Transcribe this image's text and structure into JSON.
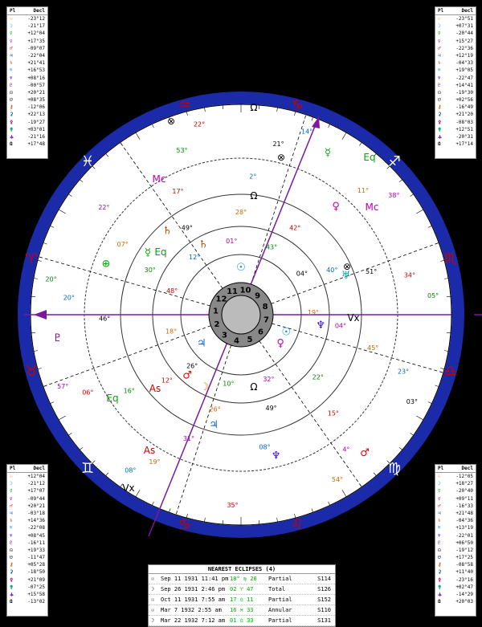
{
  "decl_tables": {
    "header_left": "Pl",
    "header_right": "Decl",
    "top_left": [
      "-23°12",
      "-21°17",
      "+12°04",
      "+17°35",
      "-09°07",
      "-22°04",
      "+21°41",
      "+16°53",
      "+08°16",
      "-00°57",
      "+20°21",
      "+08°35",
      "-12°06",
      "+22°13",
      "-19°27",
      "+03°01",
      "-21°16",
      "+17°48"
    ],
    "top_right": [
      "-23°51",
      "+07°31",
      "-20°44",
      "+15°27",
      "-22°36",
      "+12°19",
      "-04°33",
      "+19°05",
      "-22°47",
      "+14°41",
      "-19°30",
      "+02°56",
      "-16°49",
      "+21°20",
      "-08°03",
      "+12°51",
      "-20°31",
      "+17°14"
    ],
    "bottom_left": [
      "+12°04",
      "-21°12",
      "+17°07",
      "-09°44",
      "+20°21",
      "-03°18",
      "+14°36",
      "-22°08",
      "+08°45",
      "-16°11",
      "+19°33",
      "-11°47",
      "+05°28",
      "-18°50",
      "+21°09",
      "-07°25",
      "+15°58",
      "-13°02"
    ],
    "bottom_right": [
      "-12°05",
      "+18°27",
      "-20°40",
      "+09°11",
      "-16°33",
      "+21°48",
      "-04°36",
      "+13°19",
      "-22°01",
      "+06°50",
      "-19°12",
      "+17°25",
      "-08°58",
      "+11°40",
      "-23°16",
      "+02°47",
      "-14°29",
      "+20°03"
    ]
  },
  "wheel": {
    "center_labels": [
      "11",
      "10",
      "9",
      "8",
      "7",
      "6",
      "5",
      "4",
      "3",
      "2",
      "1",
      "12"
    ],
    "house_arrow_labels": [
      "Ω",
      "Ω",
      "Ω",
      "⊗",
      "⊗",
      "⊗",
      "Eq",
      "Eq",
      "Eq",
      "As",
      "As",
      "Mc",
      "Mc",
      "Vx",
      "Vx"
    ],
    "degree_labels": [
      "19°",
      "12°",
      "2°",
      "4°",
      "20°",
      "04°",
      "26°",
      "17°",
      "23°",
      "57°",
      "43°",
      "49°",
      "07°",
      "34°",
      "08°",
      "01°",
      "22°",
      "46°",
      "11°",
      "35°",
      "12°",
      "04°",
      "16°",
      "21°",
      "54°",
      "48°",
      "40°",
      "31°",
      "53°",
      "03°",
      "18°",
      "42°",
      "08°",
      "22°",
      "05°",
      "26°",
      "28°",
      "15°",
      "20°",
      "38°",
      "10°",
      "49°",
      "45°",
      "06°",
      "14°",
      "32°",
      "30°",
      "51°",
      "19°",
      "22°"
    ],
    "colors": {
      "ring": "#1a2aa8",
      "axis": "#7a1aa0",
      "band": "#e8e8e8",
      "cusp": "#000"
    }
  },
  "eclipse": {
    "title": "NEAREST ECLIPSES (4)",
    "rows": [
      {
        "icon": "☉",
        "date": "Sep 11 1931 11:41 pm",
        "pos": "18° ♍ 20",
        "type": "Partial",
        "saros": "S114"
      },
      {
        "icon": "☽",
        "date": "Sep 26 1931 2:46 pm",
        "pos": "02 ♈ 47",
        "type": "Total",
        "saros": "S126"
      },
      {
        "icon": "☉",
        "date": "Oct 11 1931 7:55 am",
        "pos": "17 ♎ 11",
        "type": "Partial",
        "saros": "S152"
      },
      {
        "icon": "☉",
        "date": "Mar 7 1932 2:55 am",
        "pos": "16 ♓ 33",
        "type": "Annular",
        "saros": "S110"
      },
      {
        "icon": "☽",
        "date": "Mar 22 1932 7:12 am",
        "pos": "01 ♎ 33",
        "type": "Partial",
        "saros": "S131"
      }
    ]
  }
}
